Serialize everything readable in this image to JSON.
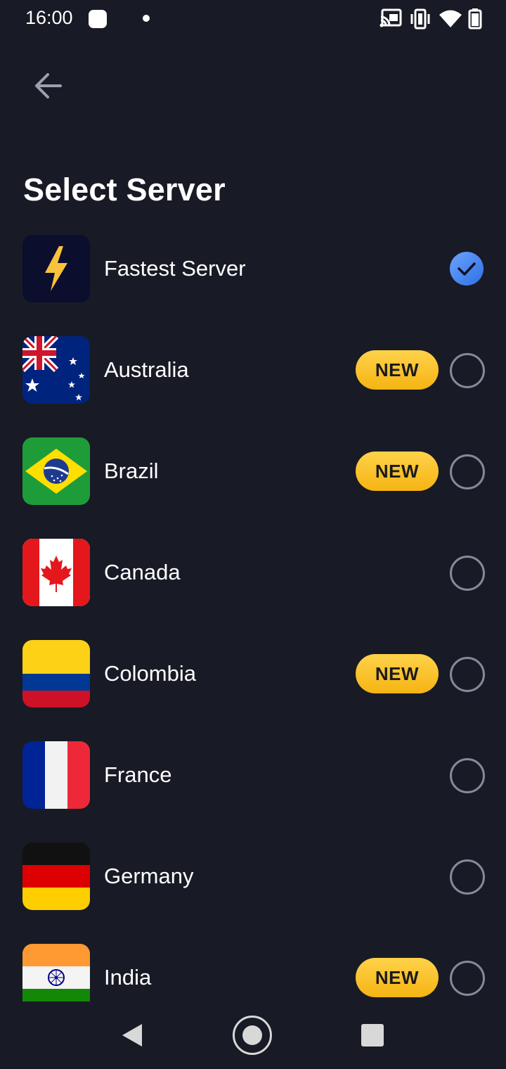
{
  "status_bar": {
    "time": "16:00",
    "icons": [
      "notification-square-icon",
      "dot-icon",
      "cast-icon",
      "vibrate-icon",
      "wifi-icon",
      "battery-icon"
    ]
  },
  "header": {
    "back_icon": "arrow-left-icon",
    "title": "Select Server"
  },
  "servers": [
    {
      "name": "Fastest Server",
      "icon": "lightning-icon",
      "is_new": false,
      "selected": true
    },
    {
      "name": "Australia",
      "icon": "flag-australia",
      "is_new": true,
      "selected": false
    },
    {
      "name": "Brazil",
      "icon": "flag-brazil",
      "is_new": true,
      "selected": false
    },
    {
      "name": "Canada",
      "icon": "flag-canada",
      "is_new": false,
      "selected": false
    },
    {
      "name": "Colombia",
      "icon": "flag-colombia",
      "is_new": true,
      "selected": false
    },
    {
      "name": "France",
      "icon": "flag-france",
      "is_new": false,
      "selected": false
    },
    {
      "name": "Germany",
      "icon": "flag-germany",
      "is_new": false,
      "selected": false
    },
    {
      "name": "India",
      "icon": "flag-india",
      "is_new": true,
      "selected": false
    }
  ],
  "badge_label": "NEW",
  "colors": {
    "background": "#181a25",
    "badge": "#f8c02a",
    "check": "#3d7cf0",
    "radio_border": "#858a99"
  },
  "nav_bar": {
    "icons": [
      "nav-back-icon",
      "nav-home-icon",
      "nav-recents-icon"
    ]
  }
}
